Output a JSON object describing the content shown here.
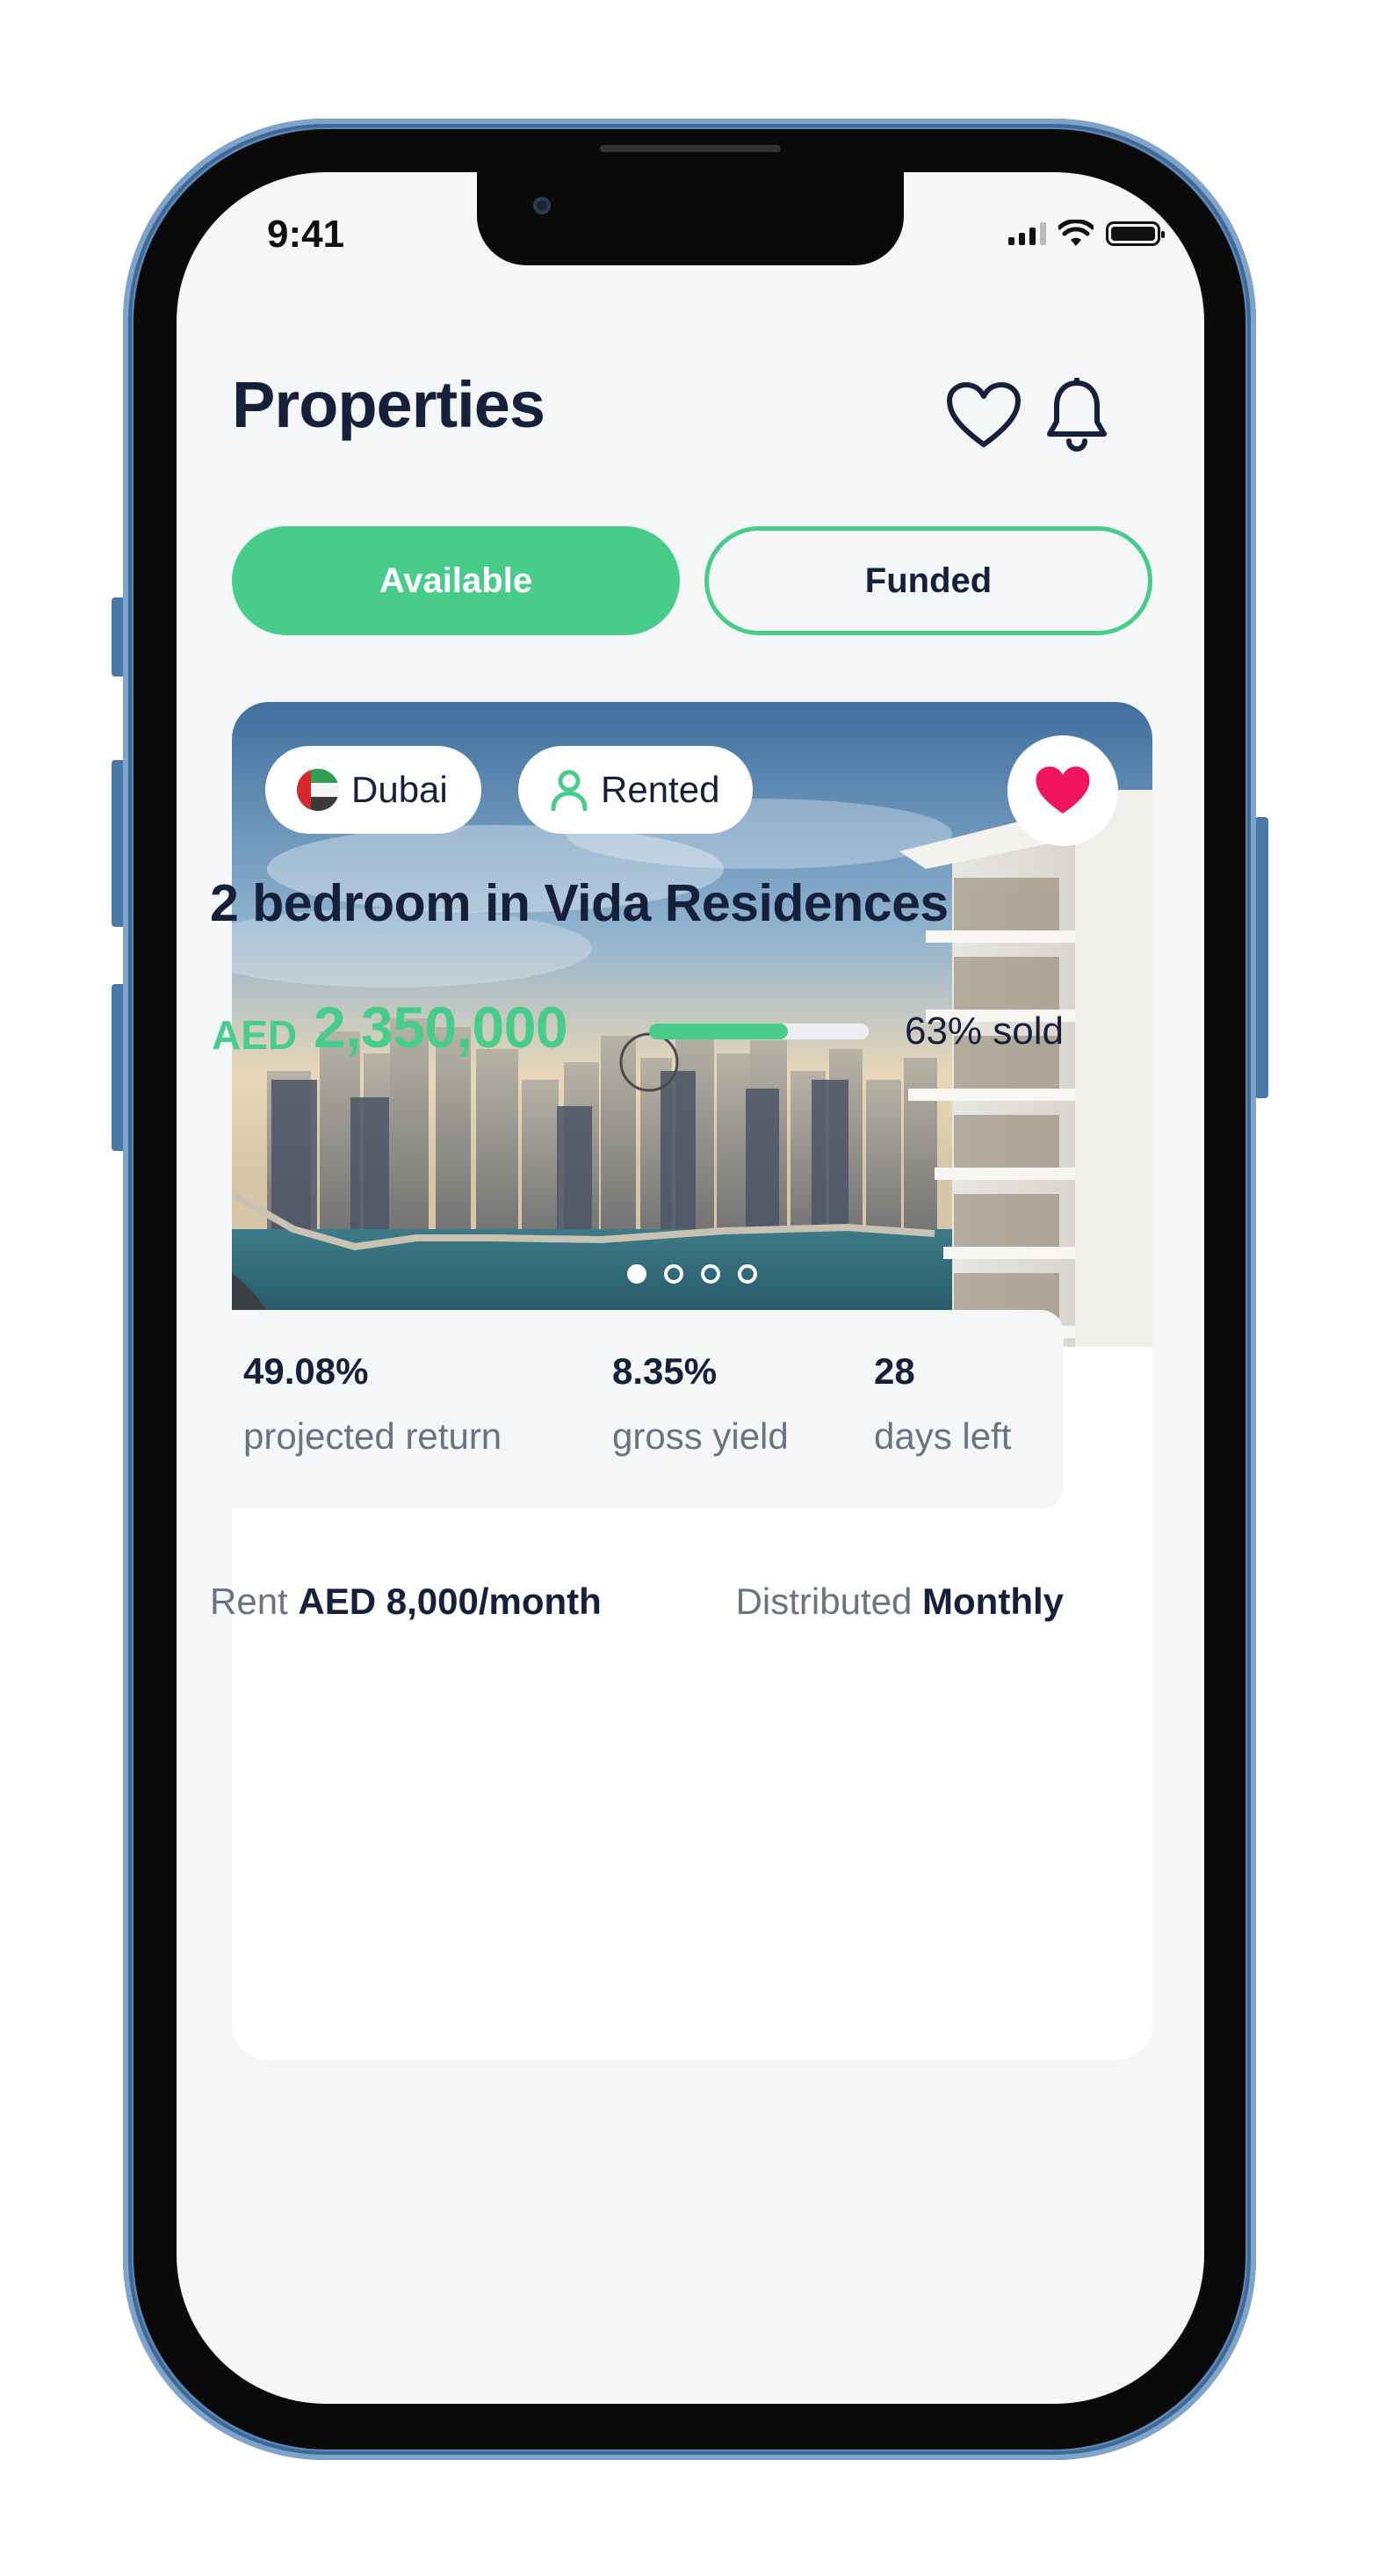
{
  "status_bar": {
    "time": "9:41"
  },
  "header": {
    "title": "Properties",
    "icons": [
      "heart-outline-icon",
      "bell-icon"
    ]
  },
  "tabs": [
    {
      "label": "Available",
      "active": true
    },
    {
      "label": "Funded",
      "active": false
    }
  ],
  "property": {
    "location": "Dubai",
    "status": "Rented",
    "favorited": true,
    "gallery": {
      "count": 4,
      "active_index": 0
    },
    "title": "2 bedroom in Vida Residences",
    "currency": "AED",
    "price": "2,350,000",
    "sold_percent": 63,
    "sold_label": "63% sold",
    "stats": [
      {
        "value": "49.08%",
        "label": "projected return"
      },
      {
        "value": "8.35%",
        "label": "gross yield"
      },
      {
        "value": "28",
        "label": "days left"
      }
    ],
    "rent_label": "Rent",
    "rent_value": "AED 8,000/month",
    "distribution_label": "Distributed",
    "distribution_value": "Monthly"
  },
  "colors": {
    "accent": "#47cc89",
    "text_primary": "#17203a",
    "text_secondary": "#6b7280",
    "background": "#f5f6f8",
    "favorite": "#f2145c"
  }
}
